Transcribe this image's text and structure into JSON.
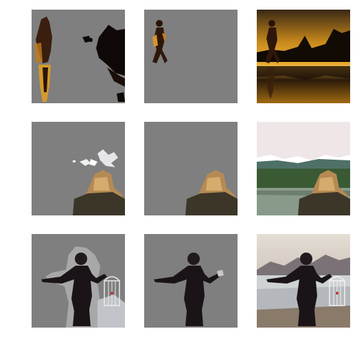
{
  "grid": {
    "rows": [
      {
        "subject": "silhouette-walking-sunset",
        "tiles": [
          {
            "kind": "rough-mask",
            "background": "#7f7f7f"
          },
          {
            "kind": "refined-mask",
            "background": "#7f7f7f"
          },
          {
            "kind": "original-photo",
            "background": "#c8901e"
          }
        ]
      },
      {
        "subject": "blonde-woman-lake",
        "tiles": [
          {
            "kind": "rough-mask",
            "background": "#7f7f7f"
          },
          {
            "kind": "refined-mask",
            "background": "#7f7f7f"
          },
          {
            "kind": "original-photo",
            "background": "#efe6e8"
          }
        ]
      },
      {
        "subject": "woman-with-birdcage",
        "tiles": [
          {
            "kind": "rough-mask",
            "background": "#7f7f7f"
          },
          {
            "kind": "refined-mask",
            "background": "#7f7f7f"
          },
          {
            "kind": "original-photo",
            "background": "#d8d0c6"
          }
        ]
      }
    ]
  },
  "colors": {
    "mask_gray": "#7f7f7f",
    "silhouette": "#1a1418",
    "sunset_gold": "#e2a52a",
    "hair_blonde": "#c89a5a"
  }
}
